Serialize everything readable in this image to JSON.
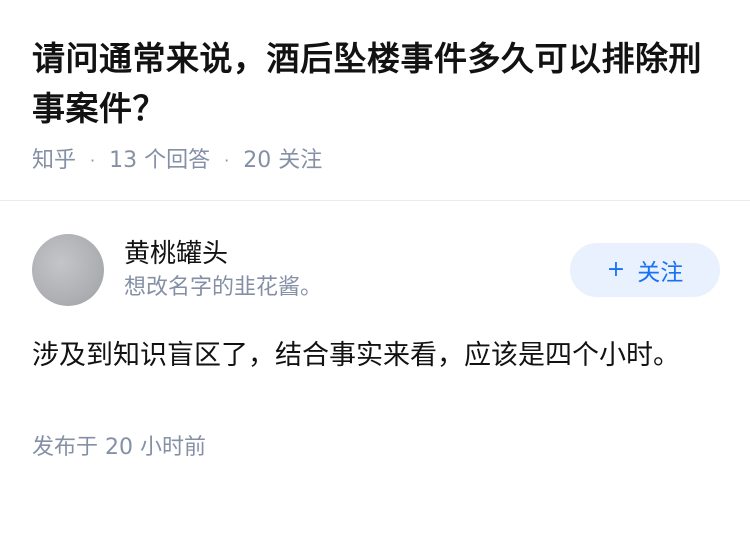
{
  "question": {
    "title": "请问通常来说，酒后坠楼事件多久可以排除刑事案件？",
    "source": "知乎",
    "answer_count": "13 个回答",
    "follow_count": "20 关注",
    "separator": "·"
  },
  "answer": {
    "author_name": "黄桃罐头",
    "author_bio": "想改名字的韭花酱。",
    "follow_button": {
      "icon": "+",
      "label": "关注"
    },
    "content": "涉及到知识盲区了，结合事实来看，应该是四个小时。",
    "time": "发布于  20 小时前"
  },
  "colors": {
    "title": "#121212",
    "meta": "#8590a6",
    "accent": "#1772f6",
    "button_bg": "#e8f1fd"
  }
}
